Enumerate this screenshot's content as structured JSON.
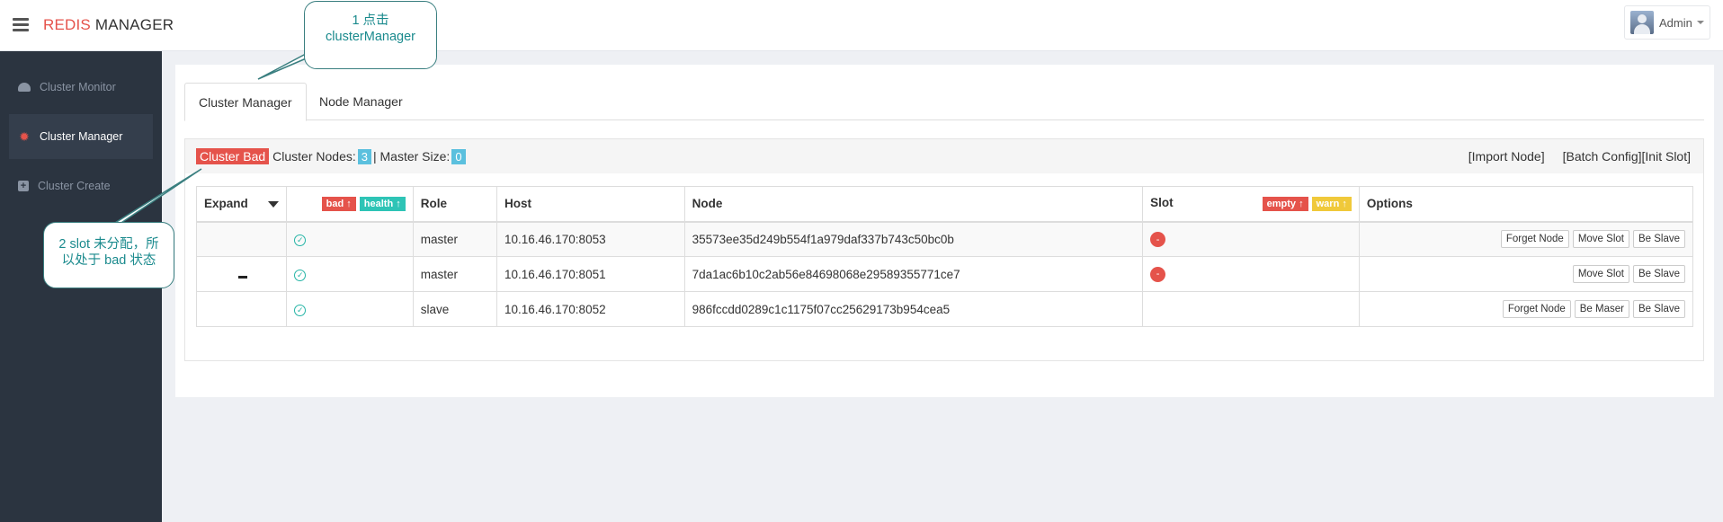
{
  "header": {
    "brand_accent": "REDIS",
    "brand_rest": " MANAGER",
    "user_name": "Admin"
  },
  "sidebar": {
    "items": [
      {
        "label": "Cluster Monitor",
        "icon": "dashboard-icon"
      },
      {
        "label": "Cluster Manager",
        "icon": "gear-icon"
      },
      {
        "label": "Cluster Create",
        "icon": "plus-square-icon"
      }
    ]
  },
  "tabs": [
    {
      "label": "Cluster Manager"
    },
    {
      "label": "Node Manager"
    }
  ],
  "status": {
    "state_badge": "Cluster Bad",
    "nodes_label": "Cluster Nodes:",
    "nodes_count": "3",
    "separator": "| Master Size:",
    "master_size": "0",
    "import_node": "[Import Node]",
    "batch_config": "[Batch Config]",
    "init_slot": "[Init Slot]"
  },
  "table": {
    "headers": {
      "expand": "Expand",
      "bad": "bad ↑",
      "health": "health ↑",
      "role": "Role",
      "host": "Host",
      "node": "Node",
      "slot": "Slot",
      "empty": "empty ↑",
      "warn": "warn ↑",
      "options": "Options"
    },
    "rows": [
      {
        "role": "master",
        "host": "10.16.46.170:8053",
        "node": "35573ee35d249b554f1a979daf337b743c50bc0b",
        "slot": "-",
        "buttons": [
          "Forget Node",
          "Move Slot",
          "Be Slave"
        ]
      },
      {
        "role": "master",
        "host": "10.16.46.170:8051",
        "node": "7da1ac6b10c2ab56e84698068e29589355771ce7",
        "slot": "-",
        "buttons": [
          "Move Slot",
          "Be Slave"
        ]
      },
      {
        "role": "slave",
        "host": "10.16.46.170:8052",
        "node": "986fccdd0289c1c1175f07cc25629173b954cea5",
        "slot": "",
        "buttons": [
          "Forget Node",
          "Be Maser",
          "Be Slave"
        ]
      }
    ]
  },
  "callouts": {
    "first": {
      "line1": "1 点击",
      "line2": "clusterManager"
    },
    "second": {
      "line1": "2 slot 未分配，所",
      "line2": "以处于 bad 状态"
    }
  },
  "colors": {
    "accent_red": "#e5534b",
    "sidebar_bg": "#2b3440",
    "teal": "#2ec4b6",
    "badge_blue": "#5bc0de",
    "warn_yellow": "#f0c93a"
  }
}
